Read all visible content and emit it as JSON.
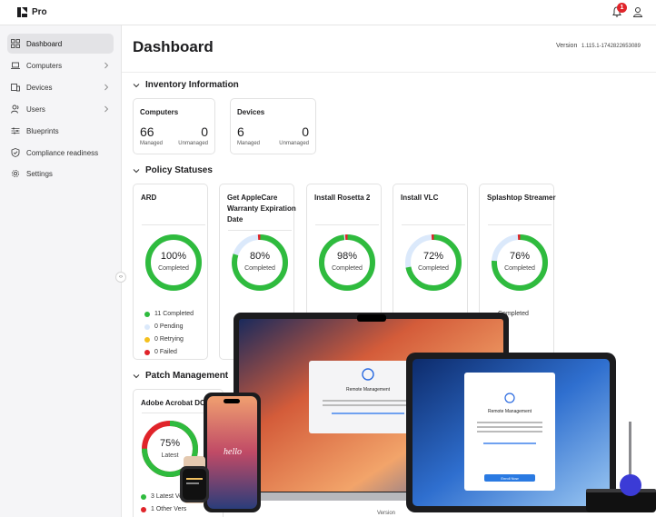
{
  "app": {
    "brand": "Pro",
    "notification_count": "1"
  },
  "colors": {
    "green": "#2fbb3e",
    "light_blue": "#dbe9fb",
    "yellow": "#f4c01e",
    "red": "#e0242a"
  },
  "sidebar": {
    "items": [
      {
        "label": "Dashboard",
        "icon": "grid-icon",
        "active": true
      },
      {
        "label": "Computers",
        "icon": "laptop-icon",
        "chevron": true
      },
      {
        "label": "Devices",
        "icon": "devices-icon",
        "chevron": true
      },
      {
        "label": "Users",
        "icon": "users-icon",
        "chevron": true
      },
      {
        "label": "Blueprints",
        "icon": "sliders-icon"
      },
      {
        "label": "Compliance readiness",
        "icon": "shield-icon"
      },
      {
        "label": "Settings",
        "icon": "gear-icon"
      }
    ],
    "collapse": "‹›"
  },
  "header": {
    "title": "Dashboard",
    "version_label": "Version",
    "version_value": "1.115.1-1742822653089"
  },
  "inventory": {
    "title": "Inventory Information",
    "cards": [
      {
        "title": "Computers",
        "managed": "66",
        "managed_label": "Managed",
        "unmanaged": "0",
        "unmanaged_label": "Unmanaged"
      },
      {
        "title": "Devices",
        "managed": "6",
        "managed_label": "Managed",
        "unmanaged": "0",
        "unmanaged_label": "Unmanaged"
      }
    ]
  },
  "policy": {
    "title": "Policy Statuses",
    "cards": [
      {
        "title": "ARD",
        "percent": "100%",
        "fraction": 1.0,
        "status": "Completed",
        "completed": "11 Completed",
        "pending": "0 Pending",
        "retrying": "0 Retrying",
        "failed": "0 Failed"
      },
      {
        "title": "Get AppleCare Warranty Expiration Date",
        "percent": "80%",
        "fraction": 0.8,
        "status": "Completed"
      },
      {
        "title": "Install Rosetta 2",
        "percent": "98%",
        "fraction": 0.98,
        "status": "Completed"
      },
      {
        "title": "Install VLC",
        "percent": "72%",
        "fraction": 0.72,
        "status": "Completed"
      },
      {
        "title": "Splashtop Streamer",
        "percent": "76%",
        "fraction": 0.76,
        "status": "Completed",
        "completed": "Completed"
      }
    ]
  },
  "patch": {
    "title": "Patch Management",
    "card": {
      "title": "Adobe Acrobat DC",
      "percent": "75%",
      "fraction": 0.75,
      "status": "Latest",
      "latest": "3 Latest Ve",
      "other": "1 Other Vers"
    }
  },
  "devices_overlay": {
    "mac_title": "Remote Management",
    "ipad_title": "Remote Management",
    "iphone_text": "hello",
    "ipad_button": "Enroll Now",
    "bottom_text": "Version"
  }
}
